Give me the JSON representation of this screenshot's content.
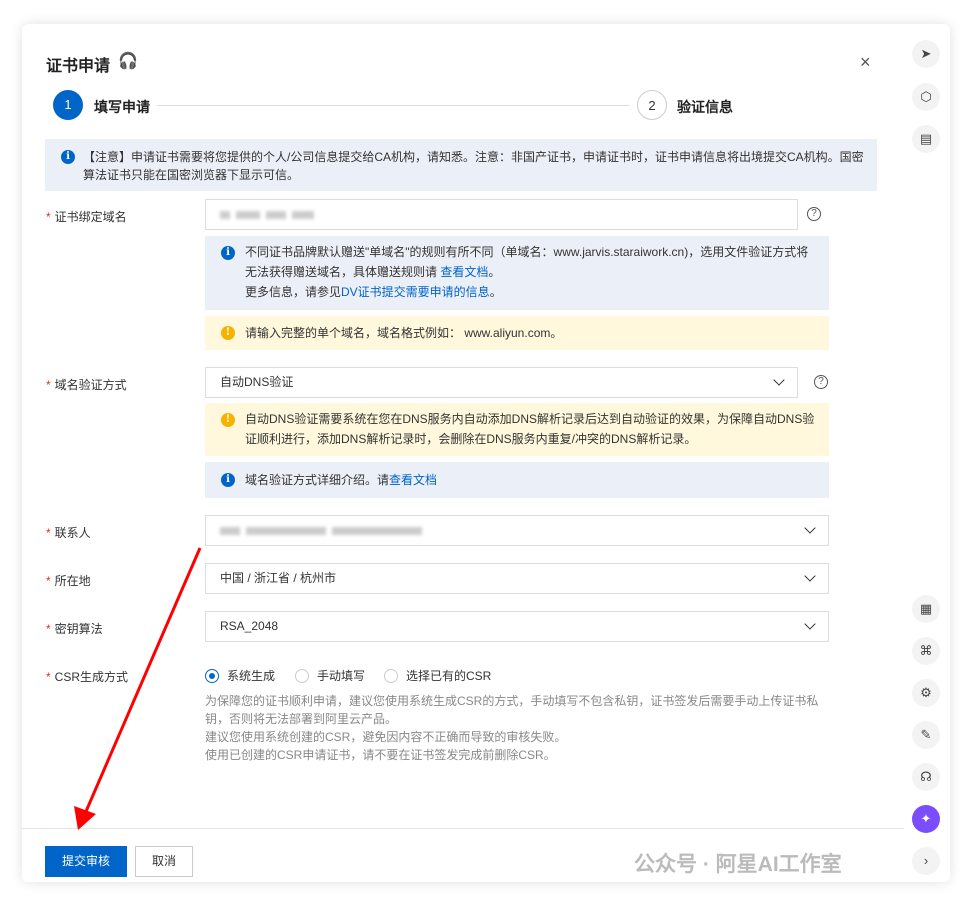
{
  "modal": {
    "title": "证书申请",
    "close": "×"
  },
  "steps": [
    {
      "num": "1",
      "label": "填写申请"
    },
    {
      "num": "2",
      "label": "验证信息"
    }
  ],
  "notice": "【注意】申请证书需要将您提供的个人/公司信息提交给CA机构，请知悉。注意：非国产证书，申请证书时，证书申请信息将出境提交CA机构。国密算法证书只能在国密浏览器下显示可信。",
  "domain": {
    "label": "证书绑定域名",
    "info_1": "不同证书品牌默认赠送\"单域名\"的规则有所不同（单域名：www.jarvis.staraiwork.cn)，选用文件验证方式将无法获得赠送域名，具体赠送规则请 ",
    "info_link": "查看文档",
    "info_end": "。",
    "info_2": "更多信息，请参见",
    "info_link2": "DV证书提交需要申请的信息",
    "info_end2": "。",
    "warn": "请输入完整的单个域名，域名格式例如： www.aliyun.com。"
  },
  "verify": {
    "label": "域名验证方式",
    "value": "自动DNS验证",
    "warn": "自动DNS验证需要系统在您在DNS服务内自动添加DNS解析记录后达到自动验证的效果，为保障自动DNS验证顺利进行，添加DNS解析记录时，会删除在DNS服务内重复/冲突的DNS解析记录。",
    "info": "域名验证方式详细介绍。请",
    "info_link": "查看文档"
  },
  "contact": {
    "label": "联系人"
  },
  "location": {
    "label": "所在地",
    "value": "中国 / 浙江省 / 杭州市"
  },
  "algo": {
    "label": "密钥算法",
    "value": "RSA_2048"
  },
  "csr": {
    "label": "CSR生成方式",
    "options": [
      "系统生成",
      "手动填写",
      "选择已有的CSR"
    ],
    "selected": "系统生成",
    "tips": [
      "为保障您的证书顺利申请，建议您使用系统生成CSR的方式，手动填写不包含私钥，证书签发后需要手动上传证书私钥，否则将无法部署到阿里云产品。",
      "建议您使用系统创建的CSR，避免因内容不正确而导致的审核失败。",
      "使用已创建的CSR申请证书，请不要在证书签发完成前删除CSR。"
    ]
  },
  "footer": {
    "submit": "提交审核",
    "cancel": "取消"
  },
  "watermark": "公众号 · 阿星AI工作室",
  "colors": {
    "primary": "#0064c8",
    "required": "#d93026",
    "arrow": "#ff0000"
  }
}
